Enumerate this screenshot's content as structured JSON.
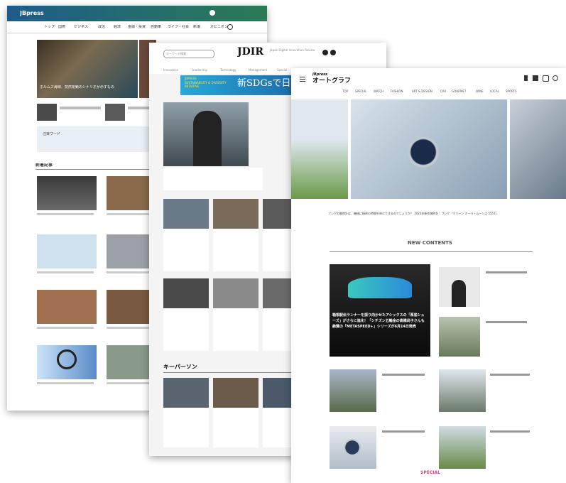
{
  "card1": {
    "brand": "JBpress",
    "nav": [
      "トップ",
      "国際",
      "ビジネス",
      "政治",
      "経済",
      "金融・投資",
      "自動車",
      "ライフ・社会",
      "新潮",
      "オピニオン"
    ],
    "hero_caption": "ホルムズ海峡、突然閉鎖のシナリオが示すもの",
    "section_heading": "新着記事",
    "tag_label": "注目ワード"
  },
  "card2": {
    "logo": "JDIR",
    "logo_sub": "Japan Digital Innovation Review",
    "banner_text": "新SDGsで日本",
    "banner_sub1": "JBPRESS",
    "banner_sub2": "SUSTAINABILITY & DIVERSITY INITIATIVE",
    "search_placeholder": "キーワード検索",
    "section_heading": "キーパーソン",
    "nav": [
      "Innovation",
      "Leadership",
      "Technology",
      "Management",
      "Special"
    ]
  },
  "card3": {
    "brand": "JBpress",
    "title": "オートグラフ",
    "nav": [
      "TOP",
      "SPECIAL",
      "WATCH",
      "FASHION",
      "ART & DESIGN",
      "CAR",
      "GOURMET",
      "WINE",
      "LOCAL",
      "SPORTS"
    ],
    "hero_caption": "ブレゲの腕時計は、機械に精密の時間を刻むできるのでしょうか？ 2023年新作腕時計：ブレゲ「マリーン オーラ・ムーンズ 5557」",
    "section_heading": "NEW CONTENTS",
    "feature_text": "箱根駅伝ランナーを振り向かせたアシックスの「厚底シューズ」がさらに進化！「シチズン五輪金の高橋尚子さんも絶賛の「METASPEED+」シリーズが6月14日発売",
    "footer_heading": "SPECIAL"
  }
}
